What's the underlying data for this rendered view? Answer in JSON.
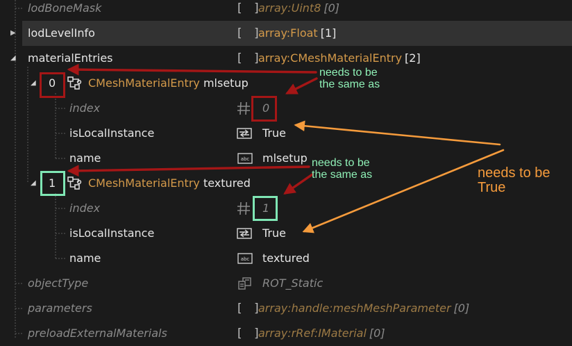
{
  "colors": {
    "background": "#1b1b1b",
    "selected_row": "#323232",
    "type_orange": "#d49a4a",
    "tree_line": "#5a5a5a",
    "marker_red": "#a51616",
    "marker_green": "#7fe6b4",
    "annotation_green": "#8ff0b6",
    "annotation_orange": "#f59b3c"
  },
  "rows": [
    {
      "label": "lodBoneMask",
      "type": "array:Uint8",
      "count": "[0]",
      "brackets": "[ ]"
    },
    {
      "label": "lodLevelInfo",
      "type": "array:Float",
      "count": "[1]",
      "brackets": "[ ]"
    },
    {
      "label": "materialEntries",
      "type": "array:CMeshMaterialEntry",
      "count": "[2]",
      "brackets": "[ ]"
    },
    {
      "index": "0",
      "class_name": "CMeshMaterialEntry",
      "name": "mlsetup"
    },
    {
      "label": "index",
      "value": "0"
    },
    {
      "label": "isLocalInstance",
      "value": "True"
    },
    {
      "label": "name",
      "value": "mlsetup"
    },
    {
      "index": "1",
      "class_name": "CMeshMaterialEntry",
      "name": "textured"
    },
    {
      "label": "index",
      "value": "1"
    },
    {
      "label": "isLocalInstance",
      "value": "True"
    },
    {
      "label": "name",
      "value": "textured"
    },
    {
      "label": "objectType",
      "value": "ROT_Static"
    },
    {
      "label": "parameters",
      "type": "array:handle:meshMeshParameter",
      "count": "[0]",
      "brackets": "[ ]"
    },
    {
      "label": "preloadExternalMaterials",
      "type": "array:rRef:IMaterial",
      "count": "[0]",
      "brackets": "[ ]"
    }
  ],
  "icons": {
    "expander": "triangle-icon",
    "struct": "struct-node-icon",
    "number": "hash-icon",
    "bool": "bool-toggle-icon",
    "string": "abc-icon",
    "enum": "enum-icon"
  },
  "annotations": {
    "note1": [
      "needs to be",
      "the same as"
    ],
    "note2": [
      "needs to be",
      "the same as"
    ],
    "note3": [
      "needs to be",
      "True"
    ]
  }
}
